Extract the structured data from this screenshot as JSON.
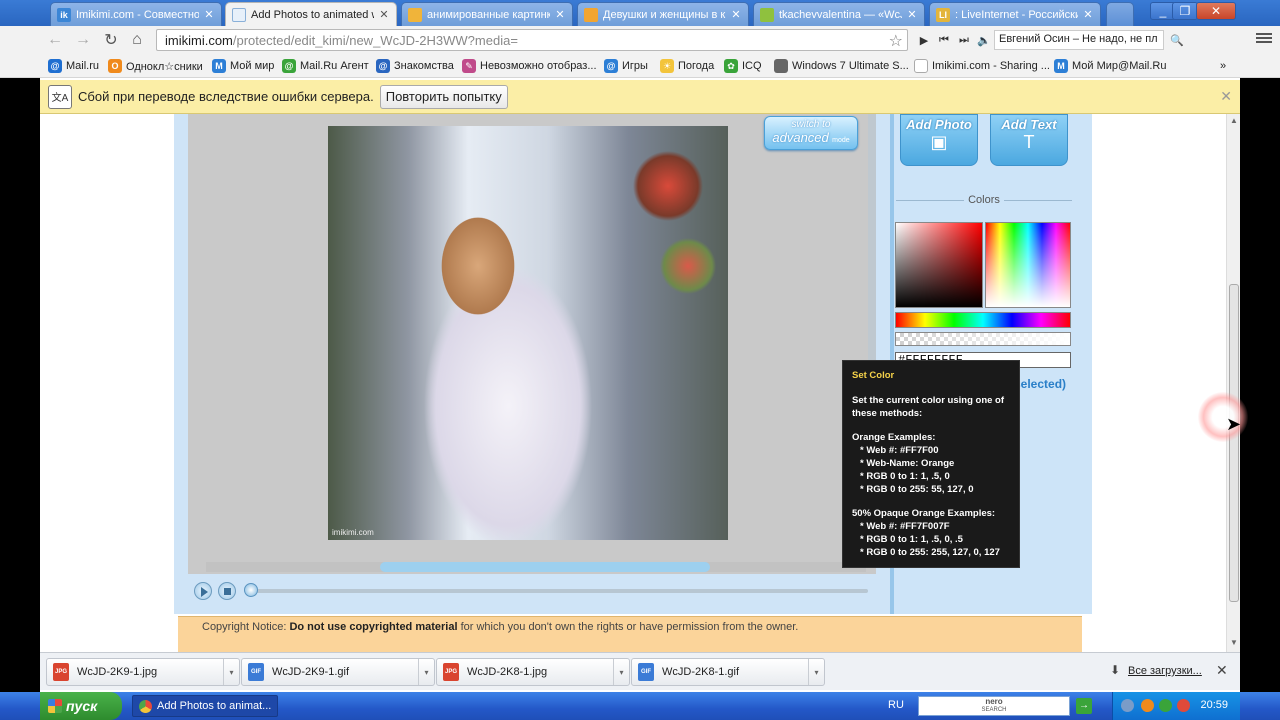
{
  "browser": {
    "tabs": [
      {
        "label": "Imikimi.com - Совместное т",
        "favicon": "ik",
        "favicon_color": "#3b86d6",
        "active": false
      },
      {
        "label": "Add Photos to animated wa",
        "favicon": "",
        "favicon_color": "#e7f0fa",
        "active": true
      },
      {
        "label": "анимированные картинки",
        "favicon": "",
        "favicon_color": "#f0b43a",
        "active": false
      },
      {
        "label": "Девушки и женщины в кр",
        "favicon": "",
        "favicon_color": "#f2a531",
        "active": false
      },
      {
        "label": "tkachevvalentina — «WcJD",
        "favicon": "",
        "favicon_color": "#8fc13e",
        "active": false
      },
      {
        "label": ": LiveInternet - Российский",
        "favicon": "LI",
        "favicon_color": "#e3b53b",
        "active": false
      }
    ],
    "close_glyph": "✕",
    "window_buttons": {
      "minimize": "_",
      "restore": "❐",
      "close": "✕"
    },
    "nav": {
      "back": "←",
      "forward": "→",
      "reload": "↻",
      "home": "⌂"
    },
    "url_host": "imikimi.com",
    "url_path": "/protected/edit_kimi/new_WcJD-2H3WW?media=",
    "bookmark_star": "☆",
    "player": {
      "play": "▶",
      "prev": "⏮",
      "next": "⏭",
      "volume": "🔈",
      "title": "Евгений Осин – Не надо, не пл",
      "search": "🔍"
    },
    "bookmarks": [
      {
        "label": "Mail.ru",
        "icon_color": "#1f6fd1"
      },
      {
        "label": "Однокл☆сники",
        "icon_color": "#f08a1c"
      },
      {
        "label": "Мой мир",
        "icon_color": "#2d7fd6"
      },
      {
        "label": "Mail.Ru Агент",
        "icon_color": "#3aa43a"
      },
      {
        "label": "Знакомства",
        "icon_color": "#2a66c0"
      },
      {
        "label": "Невозможно отобраз...",
        "icon_color": "#c04a8a"
      },
      {
        "label": "Игры",
        "icon_color": "#2d7fd6"
      },
      {
        "label": "Погода",
        "icon_color": "#f3c43b"
      },
      {
        "label": "ICQ",
        "icon_color": "#3aa43a"
      },
      {
        "label": "Windows 7 Ultimate S...",
        "icon_color": "#666666"
      },
      {
        "label": "Imikimi.com - Sharing ...",
        "icon_color": "#dddddd"
      },
      {
        "label": "Мой Мир@Mail.Ru",
        "icon_color": "#2d7fd6"
      }
    ],
    "bookmarks_more": "»"
  },
  "infobar": {
    "message": "Сбой при переводе вследствие ошибки сервера.",
    "retry_label": "Повторить попытку",
    "close_glyph": "✕"
  },
  "editor": {
    "switch_line1": "switch to",
    "switch_line2": "advanced",
    "switch_line3": "mode",
    "photo_watermark": "imikimi.com",
    "add_photo_label": "Add Photo",
    "add_text_label": "Add Text",
    "colors_label": "Colors",
    "hex_value": "#FFFFFFFF",
    "properties_label": "Properties (nothing selected)",
    "tooltip": {
      "title": "Set Color",
      "intro": "Set the current color using one of these methods:",
      "orange_heading": "Orange Examples:",
      "orange_web": "* Web #:  #FF7F00",
      "orange_name": "* Web-Name:  Orange",
      "orange_rgb1": "* RGB 0 to 1:  1, .5, 0",
      "orange_rgb255": "* RGB 0 to 255:  55, 127, 0",
      "opaque_heading": "50% Opaque Orange Examples:",
      "opaque_web": "* Web #:  #FF7F007F",
      "opaque_rgb1": "* RGB 0 to 1:  1, .5, 0, .5",
      "opaque_rgb255": "* RGB 0 to 255:  255, 127, 0, 127"
    },
    "copyright_prefix": "Copyright Notice: ",
    "copyright_bold": "Do not use copyrighted material",
    "copyright_suffix": " for which you don't own the rights or have permission from the owner."
  },
  "downloads": {
    "items": [
      {
        "name": "WcJD-2K9-1.jpg",
        "type": "JPG",
        "color": "#d9442f"
      },
      {
        "name": "WcJD-2K9-1.gif",
        "type": "GIF",
        "color": "#3b7bd6"
      },
      {
        "name": "WcJD-2K8-1.jpg",
        "type": "JPG",
        "color": "#d9442f"
      },
      {
        "name": "WcJD-2K8-1.gif",
        "type": "GIF",
        "color": "#3b7bd6"
      }
    ],
    "all_label": "Все загрузки...",
    "all_icon": "⬇",
    "close_glyph": "✕",
    "dropdown_glyph": "▾"
  },
  "taskbar": {
    "start_label": "пуск",
    "task_label": "Add Photos to animat...",
    "lang": "RU",
    "nero_line1": "nero",
    "nero_line2": "SEARCH",
    "go_glyph": "→",
    "clock": "20:59"
  }
}
